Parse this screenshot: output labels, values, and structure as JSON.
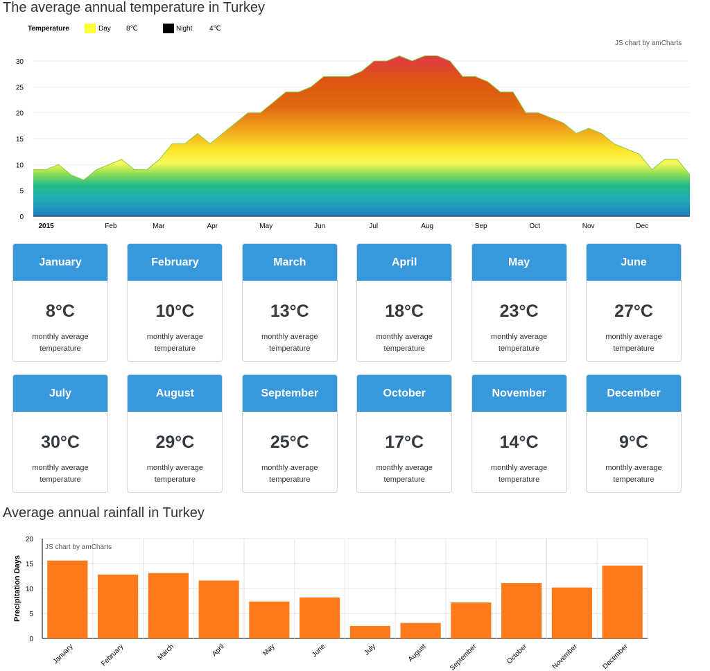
{
  "temperature": {
    "title": "The average annual temperature in Turkey",
    "legend": {
      "title": "Temperature",
      "items": [
        {
          "label": "Day",
          "value": "8℃",
          "color": "#fdfd3a"
        },
        {
          "label": "Night",
          "value": "4℃",
          "color": "#000000"
        }
      ]
    },
    "credit": "JS chart by amCharts"
  },
  "months": [
    {
      "name": "January",
      "temp": "8°C",
      "desc": "monthly average temperature"
    },
    {
      "name": "February",
      "temp": "10°C",
      "desc": "monthly average temperature"
    },
    {
      "name": "March",
      "temp": "13°C",
      "desc": "monthly average temperature"
    },
    {
      "name": "April",
      "temp": "18°C",
      "desc": "monthly average temperature"
    },
    {
      "name": "May",
      "temp": "23°C",
      "desc": "monthly average temperature"
    },
    {
      "name": "June",
      "temp": "27°C",
      "desc": "monthly average temperature"
    },
    {
      "name": "July",
      "temp": "30°C",
      "desc": "monthly average temperature"
    },
    {
      "name": "August",
      "temp": "29°C",
      "desc": "monthly average temperature"
    },
    {
      "name": "September",
      "temp": "25°C",
      "desc": "monthly average temperature"
    },
    {
      "name": "October",
      "temp": "17°C",
      "desc": "monthly average temperature"
    },
    {
      "name": "November",
      "temp": "14°C",
      "desc": "monthly average temperature"
    },
    {
      "name": "December",
      "temp": "9°C",
      "desc": "monthly average temperature"
    }
  ],
  "rainfall": {
    "title": "Average annual rainfall in Turkey",
    "credit": "JS chart by amCharts"
  },
  "colors": {
    "card_header": "#3798db",
    "bar": "#ff7a1a",
    "area_line": "#88cc44"
  },
  "chart_data": [
    {
      "type": "area",
      "title": "The average annual temperature in Turkey",
      "xlabel": "",
      "ylabel": "",
      "ylim": [
        0,
        30
      ],
      "yticks": [
        0,
        5,
        10,
        15,
        20,
        25,
        30
      ],
      "x_tick_labels": [
        "2015",
        "Feb",
        "Mar",
        "Apr",
        "May",
        "Jun",
        "Jul",
        "Aug",
        "Sep",
        "Oct",
        "Nov",
        "Dec"
      ],
      "x_tick_positions": [
        0.5,
        6.5,
        10.5,
        15,
        19.5,
        24,
        28.5,
        33,
        37.5,
        42,
        46.5,
        51
      ],
      "x_range": [
        0,
        55
      ],
      "y": [
        9,
        9,
        10,
        8,
        7,
        9,
        10,
        11,
        9,
        9,
        11,
        14,
        14,
        16,
        14,
        16,
        18,
        20,
        20,
        22,
        24,
        24,
        25,
        27,
        27,
        27,
        28,
        30,
        30,
        31,
        30,
        31,
        31,
        30,
        27,
        27,
        26,
        24,
        24,
        20,
        20,
        19,
        18,
        16,
        17,
        16,
        14,
        13,
        12,
        9,
        11,
        11,
        8
      ],
      "grid": true,
      "legend": "top-left",
      "series": [
        {
          "name": "Day"
        },
        {
          "name": "Night"
        }
      ]
    },
    {
      "type": "bar",
      "title": "Average annual rainfall in Turkey",
      "categories": [
        "January",
        "February",
        "March",
        "April",
        "May",
        "June",
        "July",
        "August",
        "September",
        "October",
        "November",
        "December"
      ],
      "values": [
        15.6,
        12.8,
        13.1,
        11.6,
        7.4,
        8.2,
        2.5,
        3.1,
        7.2,
        11.1,
        10.2,
        14.6
      ],
      "xlabel": "",
      "ylabel": "Precipitation Days",
      "ylim": [
        0,
        20
      ],
      "yticks": [
        0,
        5,
        10,
        15,
        20
      ],
      "grid": true
    }
  ]
}
